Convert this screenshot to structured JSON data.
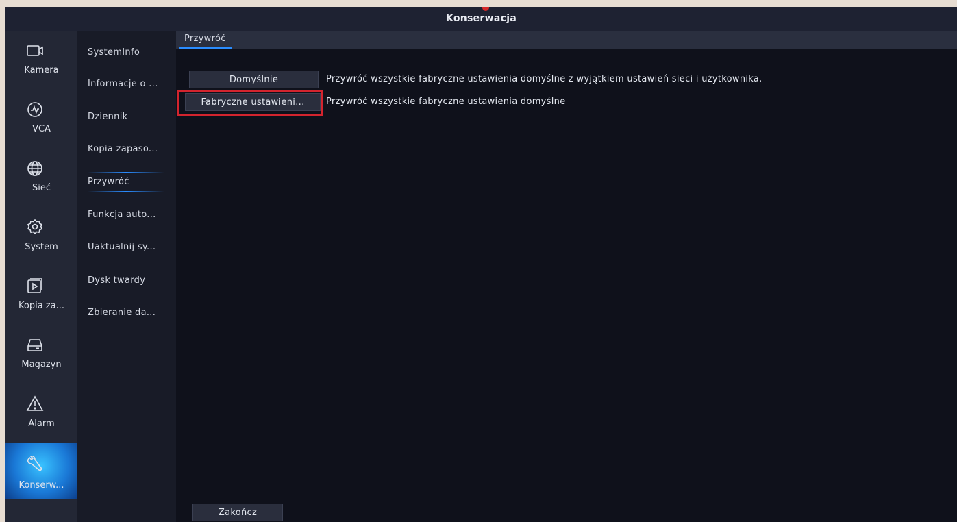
{
  "window": {
    "title": "Konserwacja"
  },
  "main_nav": {
    "items": [
      {
        "label": "Kamera",
        "icon": "camera-icon"
      },
      {
        "label": "VCA",
        "icon": "vca-icon"
      },
      {
        "label": "Sieć",
        "icon": "globe-icon"
      },
      {
        "label": "System",
        "icon": "gear-icon"
      },
      {
        "label": "Kopia za...",
        "icon": "playback-icon"
      },
      {
        "label": "Magazyn",
        "icon": "storage-icon"
      },
      {
        "label": "Alarm",
        "icon": "alarm-icon"
      },
      {
        "label": "Konserw...",
        "icon": "wrench-icon",
        "active": true
      }
    ]
  },
  "sub_nav": {
    "items": [
      {
        "label": "SystemInfo"
      },
      {
        "label": "Informacje o ..."
      },
      {
        "label": "Dziennik"
      },
      {
        "label": "Kopia zapaso..."
      },
      {
        "label": "Przywróć",
        "active": true
      },
      {
        "label": "Funkcja auto..."
      },
      {
        "label": "Uaktualnij sy..."
      },
      {
        "label": "Dysk twardy"
      },
      {
        "label": "Zbieranie da..."
      }
    ]
  },
  "tabs": [
    {
      "label": "Przywróć",
      "active": true
    }
  ],
  "restore": {
    "default_button": "Domyślnie",
    "default_desc": "Przywróć wszystkie fabryczne ustawienia domyślne z wyjątkiem ustawień sieci i użytkownika.",
    "factory_button": "Fabryczne ustawieni...",
    "factory_desc": "Przywróć wszystkie fabryczne ustawienia domyślne"
  },
  "footer": {
    "exit_button": "Zakończ"
  },
  "colors": {
    "accent": "#2a8cff",
    "highlight": "#d3242e",
    "background": "#0f111b"
  }
}
